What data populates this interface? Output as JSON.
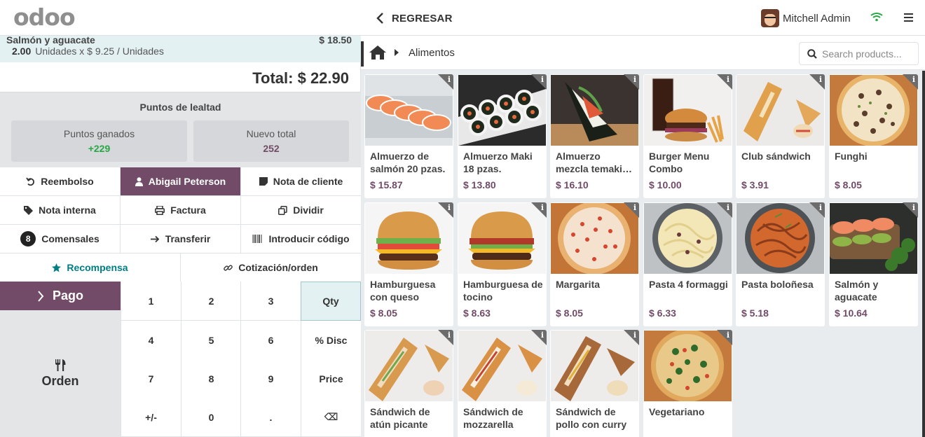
{
  "topbar": {
    "logo_text": "odoo",
    "back_label": "REGRESAR",
    "user_name": "Mitchell Admin"
  },
  "orderline": {
    "product": "Salmón y aguacate",
    "price": "$ 18.50",
    "qty": "2.00",
    "unit_detail": "Unidades x $ 9.25 / Unidades"
  },
  "total": "Total: $ 22.90",
  "loyalty": {
    "title": "Puntos de lealtad",
    "earned_label": "Puntos ganados",
    "earned_value": "+229",
    "new_total_label": "Nuevo total",
    "new_total_value": "252"
  },
  "actions": {
    "refund": "Reembolso",
    "customer": "Abigail Peterson",
    "customer_note": "Nota de cliente",
    "internal_note": "Nota interna",
    "invoice": "Factura",
    "split": "Dividir",
    "guests_count": "8",
    "guests": "Comensales",
    "transfer": "Transferir",
    "enter_code": "Introducir código",
    "reward": "Recompensa",
    "quotation": "Cotización/orden"
  },
  "pay_label": "Pago",
  "order_label": "Orden",
  "numpad": {
    "keys": [
      "1",
      "2",
      "3",
      "Qty",
      "4",
      "5",
      "6",
      "% Disc",
      "7",
      "8",
      "9",
      "Price",
      "+/-",
      "0",
      ".",
      "⌫"
    ]
  },
  "breadcrumb": "Alimentos",
  "search": {
    "placeholder": "Search products..."
  },
  "products": [
    {
      "name": "Almuerzo de salmón 20 pzas.",
      "price": "$ 15.87"
    },
    {
      "name": "Almuerzo Maki 18 pzas.",
      "price": "$ 13.80"
    },
    {
      "name": "Almuerzo mezcla temaki…",
      "price": "$ 16.10"
    },
    {
      "name": "Burger Menu Combo",
      "price": "$ 10.00"
    },
    {
      "name": "Club sándwich",
      "price": "$ 3.91"
    },
    {
      "name": "Funghi",
      "price": "$ 8.05"
    },
    {
      "name": "Hamburguesa con queso",
      "price": "$ 8.05"
    },
    {
      "name": "Hamburguesa de tocino",
      "price": "$ 8.63"
    },
    {
      "name": "Margarita",
      "price": "$ 8.05"
    },
    {
      "name": "Pasta 4 formaggi",
      "price": "$ 6.33"
    },
    {
      "name": "Pasta boloñesa",
      "price": "$ 5.18"
    },
    {
      "name": "Salmón y aguacate",
      "price": "$ 10.64"
    },
    {
      "name": "Sándwich de atún picante",
      "price": ""
    },
    {
      "name": "Sándwich de mozzarella",
      "price": ""
    },
    {
      "name": "Sándwich de pollo con curry",
      "price": ""
    },
    {
      "name": "Vegetariano",
      "price": ""
    }
  ],
  "colors": {
    "brand": "#714b67",
    "accent_teal": "#017e84",
    "positive": "#28a745"
  }
}
